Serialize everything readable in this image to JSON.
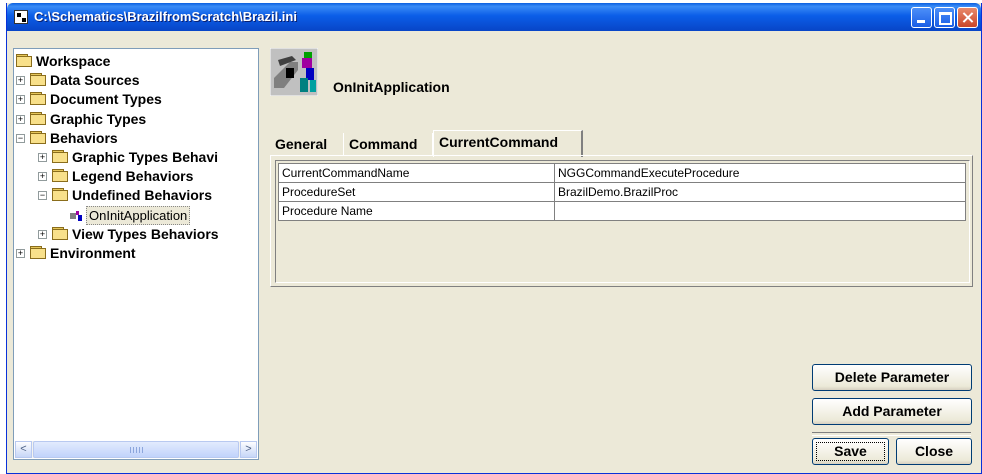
{
  "window": {
    "title": "C:\\Schematics\\BrazilfromScratch\\Brazil.ini"
  },
  "tree": {
    "nodes": [
      {
        "label": "Workspace",
        "expander": "",
        "folder": "open"
      },
      {
        "label": "Data Sources",
        "expander": "+",
        "folder": "closed"
      },
      {
        "label": "Document Types",
        "expander": "+",
        "folder": "closed"
      },
      {
        "label": "Graphic Types",
        "expander": "+",
        "folder": "closed"
      },
      {
        "label": "Behaviors",
        "expander": "−",
        "folder": "open"
      },
      {
        "label": "Graphic Types Behavi",
        "expander": "+",
        "folder": "closed"
      },
      {
        "label": "Legend Behaviors",
        "expander": "+",
        "folder": "closed"
      },
      {
        "label": "Undefined Behaviors",
        "expander": "−",
        "folder": "open"
      },
      {
        "label": "OnInitApplication",
        "expander": "",
        "folder": "leaf",
        "selected": true
      },
      {
        "label": "View Types Behaviors",
        "expander": "+",
        "folder": "closed"
      },
      {
        "label": "Environment",
        "expander": "+",
        "folder": "closed"
      }
    ],
    "scroll_left": "<",
    "scroll_right": ">"
  },
  "object": {
    "name": "OnInitApplication"
  },
  "tabs": [
    {
      "label": "General",
      "active": false
    },
    {
      "label": "Command",
      "active": false
    },
    {
      "label": "CurrentCommand",
      "active": true
    }
  ],
  "properties": [
    {
      "key": "CurrentCommandName",
      "value": "NGGCommandExecuteProcedure"
    },
    {
      "key": "ProcedureSet",
      "value": "BrazilDemo.BrazilProc"
    },
    {
      "key": "Procedure Name",
      "value": ""
    }
  ],
  "buttons": {
    "delete_parameter": "Delete Parameter",
    "add_parameter": "Add Parameter",
    "save": "Save",
    "close": "Close"
  },
  "colors": {
    "titlebar": "#0b5ee8",
    "window_bg": "#ece9d8",
    "close_button": "#c8452a"
  }
}
